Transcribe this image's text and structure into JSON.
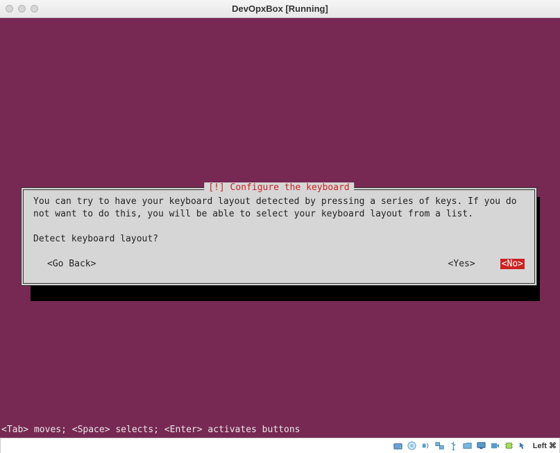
{
  "window": {
    "title": "DevOpxBox [Running]"
  },
  "dialog": {
    "title": "[!] Configure the keyboard",
    "body": "You can try to have your keyboard layout detected by pressing a series of keys. If you do not want to do this, you will be able to select your keyboard layout from a list.",
    "prompt": "Detect keyboard layout?",
    "go_back": "<Go Back>",
    "yes": "<Yes>",
    "no": "<No>"
  },
  "help": "<Tab> moves; <Space> selects; <Enter> activates buttons",
  "statusbar": {
    "modifier": "Left ⌘"
  }
}
